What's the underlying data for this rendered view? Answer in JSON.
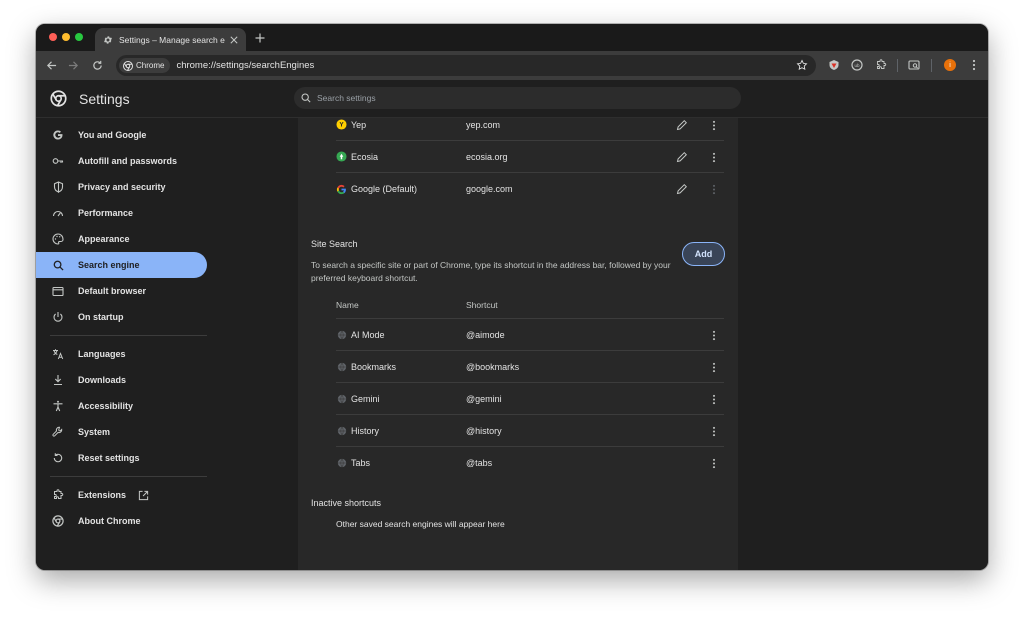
{
  "window": {
    "tab_title": "Settings – Manage search en",
    "url": "chrome://settings/searchEngines",
    "chip_label": "Chrome",
    "avatar_initial": "i"
  },
  "header": {
    "title": "Settings",
    "search_placeholder": "Search settings"
  },
  "sidebar": {
    "items": [
      {
        "label": "You and Google",
        "icon": "google-g-icon"
      },
      {
        "label": "Autofill and passwords",
        "icon": "key-icon"
      },
      {
        "label": "Privacy and security",
        "icon": "shield-icon"
      },
      {
        "label": "Performance",
        "icon": "speedometer-icon"
      },
      {
        "label": "Appearance",
        "icon": "palette-icon"
      },
      {
        "label": "Search engine",
        "icon": "search-icon",
        "active": true
      },
      {
        "label": "Default browser",
        "icon": "browser-window-icon"
      },
      {
        "label": "On startup",
        "icon": "power-icon"
      },
      {
        "label": "Languages",
        "icon": "translate-icon"
      },
      {
        "label": "Downloads",
        "icon": "download-icon"
      },
      {
        "label": "Accessibility",
        "icon": "accessibility-icon"
      },
      {
        "label": "System",
        "icon": "wrench-icon"
      },
      {
        "label": "Reset settings",
        "icon": "reset-icon"
      },
      {
        "label": "Extensions",
        "icon": "puzzle-icon"
      },
      {
        "label": "About Chrome",
        "icon": "chrome-icon"
      }
    ]
  },
  "search_engines": [
    {
      "name": "Yep",
      "shortcut": "yep.com",
      "icon": "yep-icon"
    },
    {
      "name": "Ecosia",
      "shortcut": "ecosia.org",
      "icon": "ecosia-icon"
    },
    {
      "name": "Google (Default)",
      "shortcut": "google.com",
      "icon": "google-icon"
    }
  ],
  "site_search": {
    "title": "Site Search",
    "description": "To search a specific site or part of Chrome, type its shortcut in the address bar, followed by your preferred keyboard shortcut.",
    "add_label": "Add",
    "col_name": "Name",
    "col_shortcut": "Shortcut",
    "rows": [
      {
        "name": "AI Mode",
        "shortcut": "@aimode"
      },
      {
        "name": "Bookmarks",
        "shortcut": "@bookmarks"
      },
      {
        "name": "Gemini",
        "shortcut": "@gemini"
      },
      {
        "name": "History",
        "shortcut": "@history"
      },
      {
        "name": "Tabs",
        "shortcut": "@tabs"
      }
    ]
  },
  "inactive": {
    "title": "Inactive shortcuts",
    "message": "Other saved search engines will appear here"
  },
  "colors": {
    "accent": "#8ab4f8",
    "background": "#1f1f1f",
    "card": "#282828"
  }
}
